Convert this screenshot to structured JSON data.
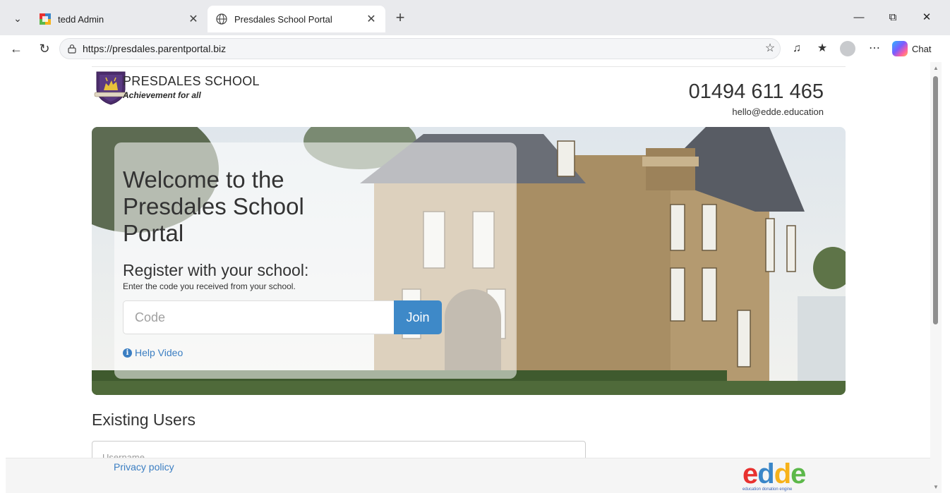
{
  "browser": {
    "tabs": [
      {
        "title": "tedd Admin",
        "active": false,
        "icon": "tedd-favicon-icon"
      },
      {
        "title": "Presdales School Portal",
        "active": true,
        "icon": "globe-icon"
      }
    ],
    "url": "https://presdales.parentportal.biz",
    "chat_label": "Chat"
  },
  "header": {
    "school_name": "PRESDALES SCHOOL",
    "tagline": "Achievement for all",
    "phone": "01494 611 465",
    "email": "hello@edde.education"
  },
  "hero": {
    "title": "Welcome to the Presdales School Portal",
    "subtitle": "Register with your school:",
    "note": "Enter the code you received from your school.",
    "code_placeholder": "Code",
    "join_label": "Join",
    "help_label": "Help Video"
  },
  "existing": {
    "heading": "Existing Users",
    "username_placeholder": "Username"
  },
  "footer": {
    "privacy_label": "Privacy policy",
    "logo_small_text": "education donation engine",
    "logo_colors": [
      "#e8312f",
      "#3a86c8",
      "#f7b21a",
      "#5cb84a"
    ]
  },
  "colors": {
    "accent": "#3e89c8",
    "link": "#3b7ec2"
  }
}
